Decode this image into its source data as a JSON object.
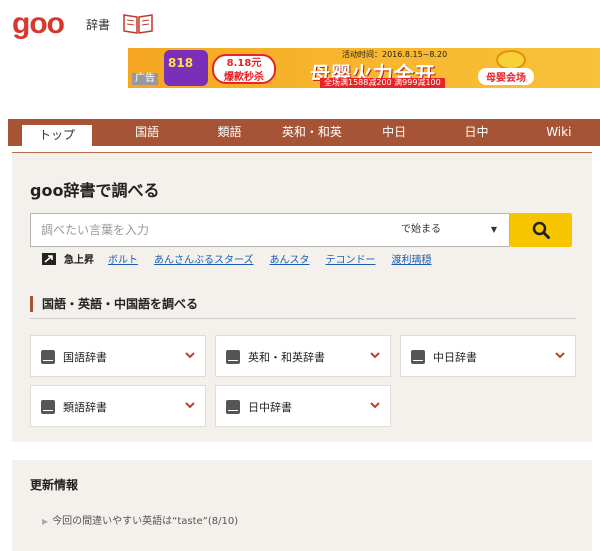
{
  "header": {
    "logo": "goo",
    "service": "辞書"
  },
  "ad": {
    "label": "广告",
    "badge": "818",
    "price_line1": "8.18元",
    "price_line2": "爆款秒杀",
    "date": "活动时间：2016.8.15~8.20",
    "title": "母婴火力全开",
    "sub": "全场满1588减200 满999减100",
    "button": "母婴会场"
  },
  "nav": {
    "tabs": [
      {
        "label": "トップ",
        "active": true
      },
      {
        "label": "国語"
      },
      {
        "label": "類語"
      },
      {
        "label": "英和・和英"
      },
      {
        "label": "中日"
      },
      {
        "label": "日中"
      },
      {
        "label": "Wiki"
      }
    ]
  },
  "search": {
    "title": "goo辞書で調べる",
    "placeholder": "調べたい言葉を入力",
    "mode": "で始まる",
    "button_icon": "search-icon"
  },
  "trending": {
    "label": "急上昇",
    "links": [
      "ボルト",
      "あんさんぶるスターズ",
      "あんスタ",
      "テコンドー",
      "渡利璃穏"
    ]
  },
  "dictionaries": {
    "heading": "国語・英語・中国語を調べる",
    "items": [
      "国語辞書",
      "英和・和英辞書",
      "中日辞書",
      "類語辞書",
      "日中辞書"
    ]
  },
  "updates": {
    "title": "更新情報",
    "items": [
      "今回の間違いやすい英語は“taste”(8/10)"
    ]
  },
  "colors": {
    "brand": "#d7372c",
    "nav": "#a65435",
    "search_button": "#f7c600",
    "link": "#1a5fb4"
  }
}
